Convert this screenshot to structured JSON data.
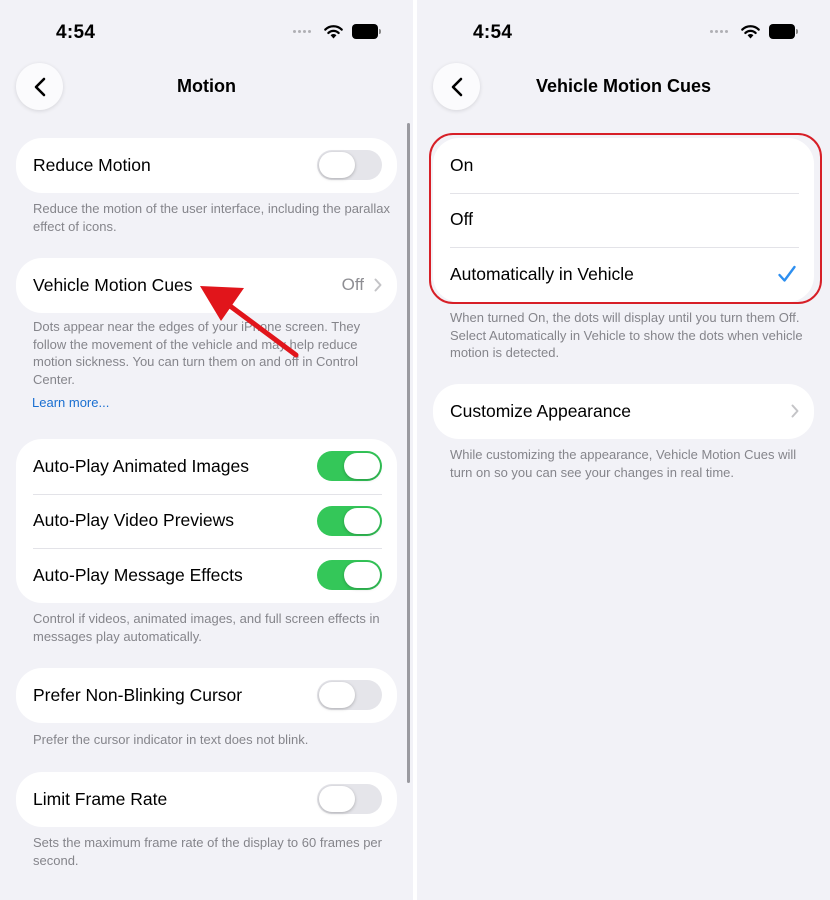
{
  "status_bar": {
    "time": "4:54"
  },
  "motion_screen": {
    "title": "Motion",
    "reduce_motion": {
      "label": "Reduce Motion",
      "enabled": false,
      "footer": "Reduce the motion of the user interface, including the parallax effect of icons."
    },
    "vehicle_motion_cues": {
      "label": "Vehicle Motion Cues",
      "value": "Off",
      "footer": "Dots appear near the edges of your iPhone screen. They follow the movement of the vehicle and may help reduce motion sickness. You can turn them on and off in Control Center.",
      "learn_more": "Learn more..."
    },
    "autoplay_group": {
      "items": [
        {
          "label": "Auto-Play Animated Images",
          "enabled": true
        },
        {
          "label": "Auto-Play Video Previews",
          "enabled": true
        },
        {
          "label": "Auto-Play Message Effects",
          "enabled": true
        }
      ],
      "footer": "Control if videos, animated images, and full screen effects in messages play automatically."
    },
    "non_blinking_cursor": {
      "label": "Prefer Non-Blinking Cursor",
      "enabled": false,
      "footer": "Prefer the cursor indicator in text does not blink."
    },
    "limit_frame_rate": {
      "label": "Limit Frame Rate",
      "enabled": false,
      "footer": "Sets the maximum frame rate of the display to 60 frames per second."
    }
  },
  "vehicle_cues_screen": {
    "title": "Vehicle Motion Cues",
    "options": [
      {
        "label": "On",
        "selected": false
      },
      {
        "label": "Off",
        "selected": false
      },
      {
        "label": "Automatically in Vehicle",
        "selected": true
      }
    ],
    "options_footer": "When turned On, the dots will display until you turn them Off. Select Automatically in Vehicle to show the dots when vehicle motion is detected.",
    "customize": {
      "label": "Customize Appearance",
      "footer": "While customizing the appearance, Vehicle Motion Cues will turn on so you can see your changes in real time."
    }
  },
  "colors": {
    "toggle_on": "#34c759",
    "toggle_off": "#e5e5ea",
    "accent_blue": "#1a6fd1",
    "checkmark": "#2d8ff0",
    "annotation_red": "#d71f27",
    "background": "#f2f2f7"
  },
  "icons": [
    "back-chevron-icon",
    "wifi-icon",
    "battery-icon",
    "chevron-right-icon",
    "checkmark-icon"
  ]
}
